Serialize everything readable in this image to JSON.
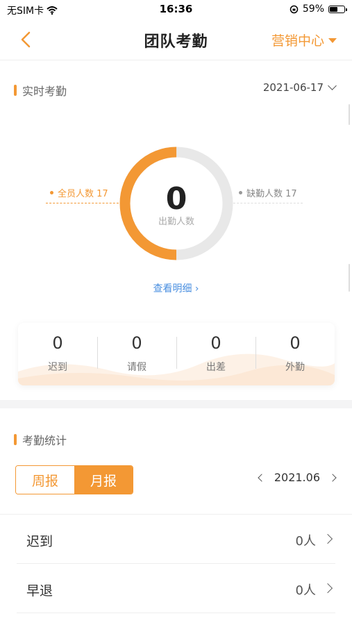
{
  "status_bar": {
    "carrier": "无SIM卡",
    "time": "16:36",
    "battery": "59%",
    "battery_fraction": 0.59
  },
  "nav": {
    "title": "团队考勤",
    "dept": "营销中心"
  },
  "realtime": {
    "title": "实时考勤",
    "date": "2021-06-17",
    "attend_value": "0",
    "attend_label": "出勤人数",
    "total_label": "全员人数 17",
    "absent_label": "缺勤人数 17",
    "detail_link": "查看明细",
    "ring": {
      "attend_fraction": 0.5,
      "present_color": "#f39834",
      "absent_color": "#e8e8e8"
    }
  },
  "stats": [
    {
      "value": "0",
      "label": "迟到"
    },
    {
      "value": "0",
      "label": "请假"
    },
    {
      "value": "0",
      "label": "出差"
    },
    {
      "value": "0",
      "label": "外勤"
    }
  ],
  "summary": {
    "title": "考勤统计",
    "tabs": [
      "周报",
      "月报"
    ],
    "active_tab": "月报",
    "month": "2021.06",
    "rows": [
      {
        "label": "迟到",
        "value": "0人"
      },
      {
        "label": "早退",
        "value": "0人"
      }
    ]
  },
  "colors": {
    "accent": "#f39834",
    "link": "#4a8fe0"
  }
}
